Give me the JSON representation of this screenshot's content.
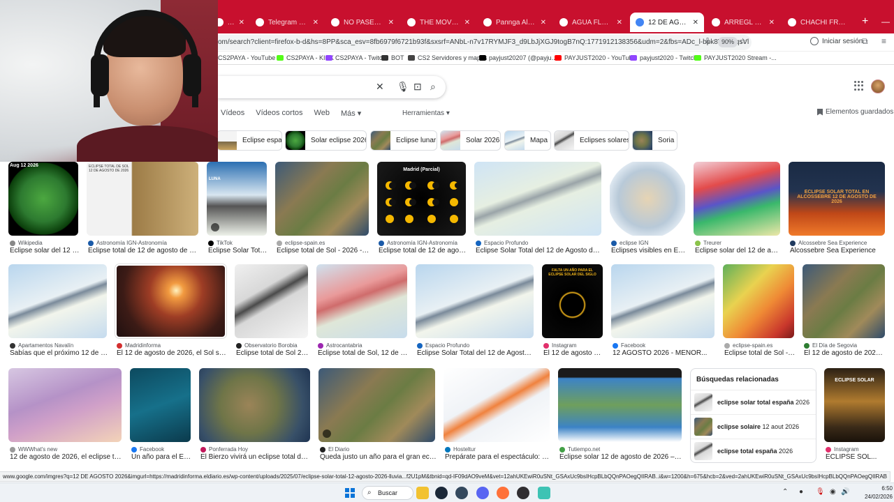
{
  "colors": {
    "tabbar": "#c8102e",
    "accent": "#1a73e8"
  },
  "tabs": [
    {
      "title": "...com",
      "active": false
    },
    {
      "title": "Telegram Web",
      "active": false
    },
    {
      "title": "NO PASES CHAMA",
      "active": false
    },
    {
      "title": "THE MOVEMENT",
      "active": false
    },
    {
      "title": "Pannga Al - El Mira",
      "active": false
    },
    {
      "title": "AGUA FLOWS 2026",
      "active": false
    },
    {
      "title": "12 DE AGOSTO 2026",
      "active": true
    },
    {
      "title": "ARREGL BAR SERIE",
      "active": false
    },
    {
      "title": "CHACHI FRIO - Buscar",
      "active": false
    }
  ],
  "address_bar": {
    "url": "om/search?client=firefox-b-d&hs=8PP&sca_esv=8fb6979f6721b93f&sxsrf=ANbL-n7v17RYMJF3_d9LbJjXGJ9togB7nQ:1771912138356&udm=2&fbs=ADc_l-bpk8W4E-qsVl",
    "zoom": "90%",
    "profile_label": "Iniciar sesión"
  },
  "bookmarks": [
    "CS2PAYA - YouTube",
    "CS2PAYA - KICK",
    "CS2PAYA - Twitch",
    "BOT",
    "CS2 Servidores y mapas",
    "payjust20207 (@payju...",
    "PAYJUST2020 - YouTube",
    "payjust2020 - Twitch",
    "PAYJUST2020 Stream -..."
  ],
  "search_tabs": [
    "Vídeos",
    "Vídeos cortos",
    "Web",
    "Más"
  ],
  "tools_label": "Herramientas",
  "saved_label": "Elementos guardados",
  "chips": [
    "Eclipse españa",
    "Solar eclipse 2026",
    "Eclipse lunar",
    "Solar 2026",
    "Mapa",
    "Eclipses solares",
    "Soria"
  ],
  "results": [
    {
      "source": "Wikipedia",
      "title": "Eclipse solar del 12 d..."
    },
    {
      "source": "Astronomía IGN-Astronomía",
      "title": "Eclipse total de 12 de agosto de 2026 ..."
    },
    {
      "source": "TikTok",
      "title": "Eclipse Solar Total..."
    },
    {
      "source": "eclipse-spain.es",
      "title": "Eclipse total de Sol - 2026 - [12..."
    },
    {
      "source": "Astronomía IGN-Astronomía",
      "title": "Eclipse total de 12 de agosto ..."
    },
    {
      "source": "Espacio Profundo",
      "title": "Eclipse Solar Total del 12 de Agosto de 202..."
    },
    {
      "source": "eclipse IGN",
      "title": "Eclipses visibles en Esp..."
    },
    {
      "source": "Treurer",
      "title": "Eclipse solar del 12 de agost..."
    },
    {
      "source": "Alcossebre Sea Experience",
      "title": "Alcossebre Sea Experience"
    },
    {
      "source": "Apartamentos Navalín",
      "title": "Sabías que el próximo 12 de ago..."
    },
    {
      "source": "Madridinforma",
      "title": "El 12 de agosto de 2026, el Sol se ap..."
    },
    {
      "source": "Observatorio Borobia",
      "title": "Eclipse total de Sol 2026"
    },
    {
      "source": "Astrocantabria",
      "title": "Eclipse total de Sol, 12 de ag..."
    },
    {
      "source": "Espacio Profundo",
      "title": "Eclipse Solar Total del 12 de Agosto de ..."
    },
    {
      "source": "Instagram",
      "title": "El 12 de agosto de..."
    },
    {
      "source": "Facebook",
      "title": "12 AGOSTO 2026 - MENOR..."
    },
    {
      "source": "eclipse-spain.es",
      "title": "Eclipse total de Sol - 2..."
    },
    {
      "source": "El Día de Segovia",
      "title": "El 12 de agosto de 2026, ni..."
    },
    {
      "source": "WWWhat's new",
      "title": "12 de agosto de 2026, el eclipse total ..."
    },
    {
      "source": "Facebook",
      "title": "Un año para el Ecli..."
    },
    {
      "source": "Ponferrada Hoy",
      "title": "El Bierzo vivirá un eclipse total de sol ..."
    },
    {
      "source": "El Diario",
      "title": "Queda justo un año para el gran eclipse..."
    },
    {
      "source": "Hosteltur",
      "title": "Prepárate para el espectáculo: Esp..."
    },
    {
      "source": "Tutiempo.net",
      "title": "Eclipse solar 12 de agosto de 2026 – Map..."
    },
    {
      "source": "Instagram",
      "title": "ECLIPSE SOL..."
    }
  ],
  "image_text": {
    "r1": "Aug 12 2026",
    "r2": "ECLIPSE TOTAL DE SOL 12 DE AGOSTO DE 2026",
    "r3": "LUNA",
    "r5": "Madrid (Parcial)",
    "r9": "ECLIPSE SOLAR TOTAL EN ALCOSSEBRE 12 DE AGOSTO DE 2026",
    "r15": "FALTA UN AÑO PARA EL ECLIPSE SOLAR DEL SIGLO",
    "r25": "ECLIPSE SOLAR"
  },
  "related": {
    "title": "Búsquedas relacionadas",
    "items": [
      {
        "bold": "eclipse solar total españa",
        "plain": " 2026"
      },
      {
        "bold": "eclipse solaire",
        "plain": " 12 aout 2026"
      },
      {
        "bold": "eclipse total españa",
        "plain": " 2026"
      }
    ]
  },
  "status_url": "www.google.com/imgres?q=12 DE AGOSTO 2026&imgurl=https://madridinforma.eldiario.es/wp-content/uploads/2025/07/eclipse-solar-total-12-agosto-2026-lluvia...f2U1pM&tbnid=qd-IF09dAO9veM&vet=12ahUKEwiR0uSNt_GSAxUc9bsIHcpBLbQQnPAOegQIIRAB..i&w=1200&h=675&hcb=2&ved=2ahUKEwiR0uSNt_GSAxUc9bsIHcpBLbQQnPAOegQIIRAB",
  "taskbar": {
    "search_label": "Buscar",
    "time": "6:50",
    "date": "24/02/2026"
  }
}
